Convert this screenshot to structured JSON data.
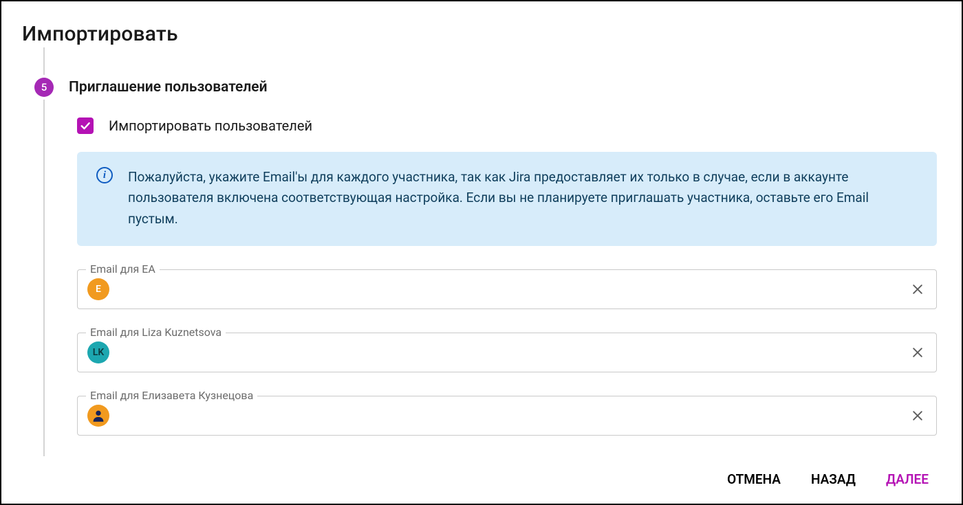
{
  "title": "Импортировать",
  "step": {
    "number": "5",
    "label": "Приглашение пользователей"
  },
  "checkbox": {
    "label": "Импортировать пользователей",
    "checked": true
  },
  "info": {
    "text": "Пожалуйста, укажите Email'ы для каждого участника, так как Jira предоставляет их только в случае, если в аккаунте пользователя включена соответствующая настройка. Если вы не планируете приглашать участника, оставьте его Email пустым."
  },
  "fields": [
    {
      "label": "Email для EA",
      "avatar_text": "E",
      "avatar_color": "orange",
      "value": ""
    },
    {
      "label": "Email для Liza Kuznetsova",
      "avatar_text": "LK",
      "avatar_color": "teal",
      "value": ""
    },
    {
      "label": "Email для Елизавета Кузнецова",
      "avatar_text": "",
      "avatar_color": "orange",
      "avatar_icon": "person",
      "value": ""
    }
  ],
  "footer": {
    "cancel": "ОТМЕНА",
    "back": "НАЗАД",
    "next": "ДАЛЕЕ"
  }
}
